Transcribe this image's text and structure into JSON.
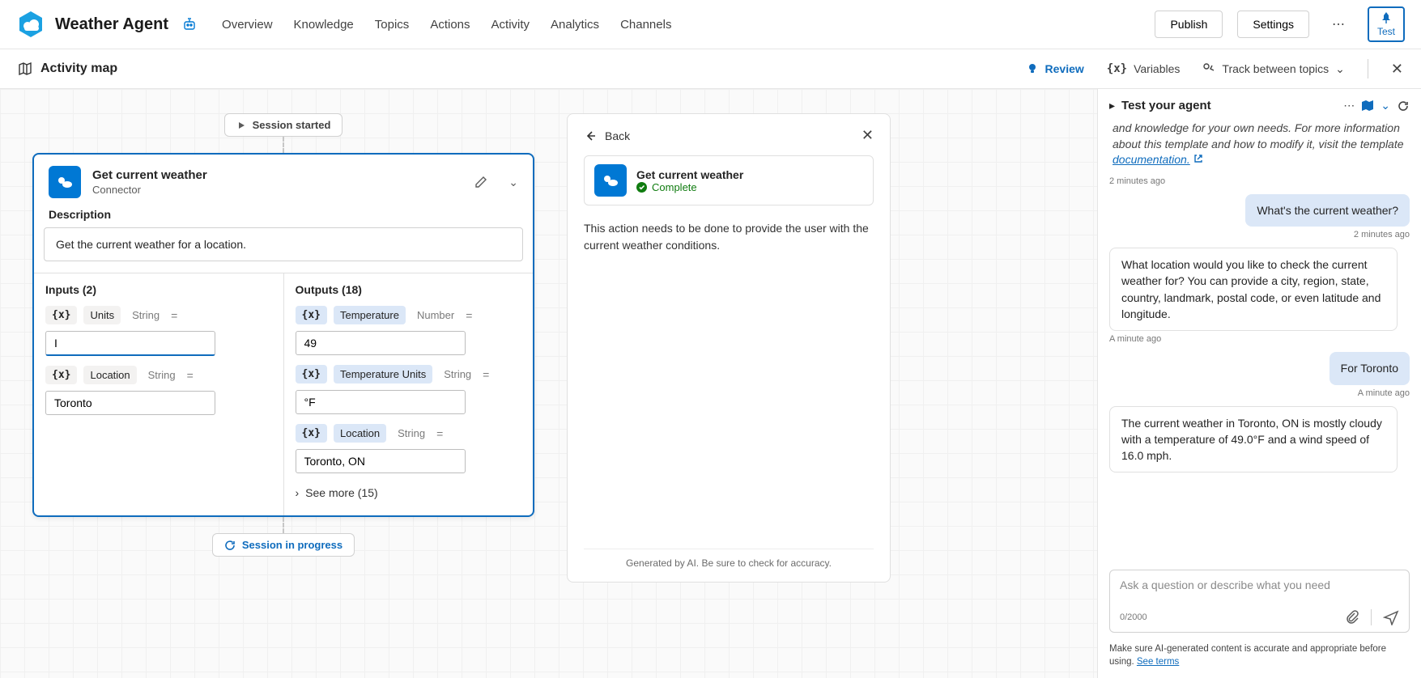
{
  "header": {
    "app_title": "Weather Agent",
    "tabs": [
      "Overview",
      "Knowledge",
      "Topics",
      "Actions",
      "Activity",
      "Analytics",
      "Channels"
    ],
    "publish": "Publish",
    "settings": "Settings",
    "test": "Test"
  },
  "subheader": {
    "title": "Activity map",
    "review": "Review",
    "variables": "Variables",
    "track": "Track between topics"
  },
  "flow": {
    "session_started": "Session started",
    "session_progress": "Session in progress"
  },
  "node": {
    "title": "Get current weather",
    "subtitle": "Connector",
    "desc_label": "Description",
    "description": "Get the current weather for a location.",
    "inputs_label": "Inputs (2)",
    "outputs_label": "Outputs (18)",
    "inputs": [
      {
        "name": "Units",
        "type": "String",
        "value": "I"
      },
      {
        "name": "Location",
        "type": "String",
        "value": "Toronto"
      }
    ],
    "outputs": [
      {
        "name": "Temperature",
        "type": "Number",
        "value": "49"
      },
      {
        "name": "Temperature Units",
        "type": "String",
        "value": "°F"
      },
      {
        "name": "Location",
        "type": "String",
        "value": "Toronto, ON"
      }
    ],
    "see_more": "See more (15)"
  },
  "details": {
    "back": "Back",
    "title": "Get current weather",
    "status": "Complete",
    "body": "This action needs to be done to provide the user with the current weather conditions.",
    "footer": "Generated by AI. Be sure to check for accuracy."
  },
  "chat": {
    "title": "Test your agent",
    "intro_prefix": "and knowledge for your own needs. For more information about this template and how to modify it, visit the template ",
    "intro_link": "documentation.",
    "ts1": "2 minutes ago",
    "m1": "What's the current weather?",
    "ts2": "2 minutes ago",
    "m2": "What location would you like to check the current weather for? You can provide a city, region, state, country, landmark, postal code, or even latitude and longitude.",
    "ts3": "A minute ago",
    "m3": "For Toronto",
    "ts4": "A minute ago",
    "m4": "The current weather in Toronto, ON is mostly cloudy with a temperature of 49.0°F and a wind speed of 16.0 mph.",
    "placeholder": "Ask a question or describe what you need",
    "char_count": "0/2000",
    "disclaimer": "Make sure AI-generated content is accurate and appropriate before using. ",
    "see_terms": "See terms"
  }
}
